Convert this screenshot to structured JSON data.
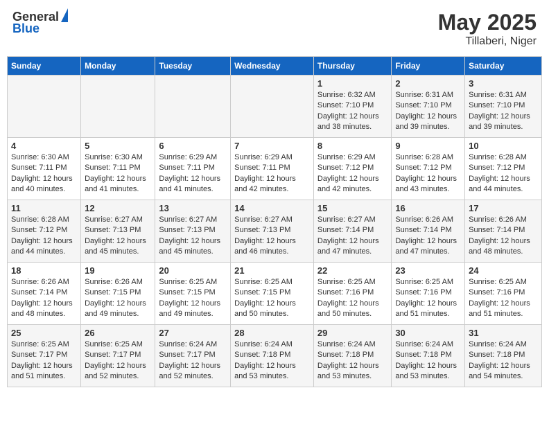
{
  "header": {
    "logo_general": "General",
    "logo_blue": "Blue",
    "title": "May 2025",
    "subtitle": "Tillaberi, Niger"
  },
  "days_of_week": [
    "Sunday",
    "Monday",
    "Tuesday",
    "Wednesday",
    "Thursday",
    "Friday",
    "Saturday"
  ],
  "weeks": [
    {
      "days": [
        {
          "num": "",
          "info": ""
        },
        {
          "num": "",
          "info": ""
        },
        {
          "num": "",
          "info": ""
        },
        {
          "num": "",
          "info": ""
        },
        {
          "num": "1",
          "info": "Sunrise: 6:32 AM\nSunset: 7:10 PM\nDaylight: 12 hours and 38 minutes."
        },
        {
          "num": "2",
          "info": "Sunrise: 6:31 AM\nSunset: 7:10 PM\nDaylight: 12 hours and 39 minutes."
        },
        {
          "num": "3",
          "info": "Sunrise: 6:31 AM\nSunset: 7:10 PM\nDaylight: 12 hours and 39 minutes."
        }
      ]
    },
    {
      "days": [
        {
          "num": "4",
          "info": "Sunrise: 6:30 AM\nSunset: 7:11 PM\nDaylight: 12 hours and 40 minutes."
        },
        {
          "num": "5",
          "info": "Sunrise: 6:30 AM\nSunset: 7:11 PM\nDaylight: 12 hours and 41 minutes."
        },
        {
          "num": "6",
          "info": "Sunrise: 6:29 AM\nSunset: 7:11 PM\nDaylight: 12 hours and 41 minutes."
        },
        {
          "num": "7",
          "info": "Sunrise: 6:29 AM\nSunset: 7:11 PM\nDaylight: 12 hours and 42 minutes."
        },
        {
          "num": "8",
          "info": "Sunrise: 6:29 AM\nSunset: 7:12 PM\nDaylight: 12 hours and 42 minutes."
        },
        {
          "num": "9",
          "info": "Sunrise: 6:28 AM\nSunset: 7:12 PM\nDaylight: 12 hours and 43 minutes."
        },
        {
          "num": "10",
          "info": "Sunrise: 6:28 AM\nSunset: 7:12 PM\nDaylight: 12 hours and 44 minutes."
        }
      ]
    },
    {
      "days": [
        {
          "num": "11",
          "info": "Sunrise: 6:28 AM\nSunset: 7:12 PM\nDaylight: 12 hours and 44 minutes."
        },
        {
          "num": "12",
          "info": "Sunrise: 6:27 AM\nSunset: 7:13 PM\nDaylight: 12 hours and 45 minutes."
        },
        {
          "num": "13",
          "info": "Sunrise: 6:27 AM\nSunset: 7:13 PM\nDaylight: 12 hours and 45 minutes."
        },
        {
          "num": "14",
          "info": "Sunrise: 6:27 AM\nSunset: 7:13 PM\nDaylight: 12 hours and 46 minutes."
        },
        {
          "num": "15",
          "info": "Sunrise: 6:27 AM\nSunset: 7:14 PM\nDaylight: 12 hours and 47 minutes."
        },
        {
          "num": "16",
          "info": "Sunrise: 6:26 AM\nSunset: 7:14 PM\nDaylight: 12 hours and 47 minutes."
        },
        {
          "num": "17",
          "info": "Sunrise: 6:26 AM\nSunset: 7:14 PM\nDaylight: 12 hours and 48 minutes."
        }
      ]
    },
    {
      "days": [
        {
          "num": "18",
          "info": "Sunrise: 6:26 AM\nSunset: 7:14 PM\nDaylight: 12 hours and 48 minutes."
        },
        {
          "num": "19",
          "info": "Sunrise: 6:26 AM\nSunset: 7:15 PM\nDaylight: 12 hours and 49 minutes."
        },
        {
          "num": "20",
          "info": "Sunrise: 6:25 AM\nSunset: 7:15 PM\nDaylight: 12 hours and 49 minutes."
        },
        {
          "num": "21",
          "info": "Sunrise: 6:25 AM\nSunset: 7:15 PM\nDaylight: 12 hours and 50 minutes."
        },
        {
          "num": "22",
          "info": "Sunrise: 6:25 AM\nSunset: 7:16 PM\nDaylight: 12 hours and 50 minutes."
        },
        {
          "num": "23",
          "info": "Sunrise: 6:25 AM\nSunset: 7:16 PM\nDaylight: 12 hours and 51 minutes."
        },
        {
          "num": "24",
          "info": "Sunrise: 6:25 AM\nSunset: 7:16 PM\nDaylight: 12 hours and 51 minutes."
        }
      ]
    },
    {
      "days": [
        {
          "num": "25",
          "info": "Sunrise: 6:25 AM\nSunset: 7:17 PM\nDaylight: 12 hours and 51 minutes."
        },
        {
          "num": "26",
          "info": "Sunrise: 6:25 AM\nSunset: 7:17 PM\nDaylight: 12 hours and 52 minutes."
        },
        {
          "num": "27",
          "info": "Sunrise: 6:24 AM\nSunset: 7:17 PM\nDaylight: 12 hours and 52 minutes."
        },
        {
          "num": "28",
          "info": "Sunrise: 6:24 AM\nSunset: 7:18 PM\nDaylight: 12 hours and 53 minutes."
        },
        {
          "num": "29",
          "info": "Sunrise: 6:24 AM\nSunset: 7:18 PM\nDaylight: 12 hours and 53 minutes."
        },
        {
          "num": "30",
          "info": "Sunrise: 6:24 AM\nSunset: 7:18 PM\nDaylight: 12 hours and 53 minutes."
        },
        {
          "num": "31",
          "info": "Sunrise: 6:24 AM\nSunset: 7:18 PM\nDaylight: 12 hours and 54 minutes."
        }
      ]
    }
  ]
}
